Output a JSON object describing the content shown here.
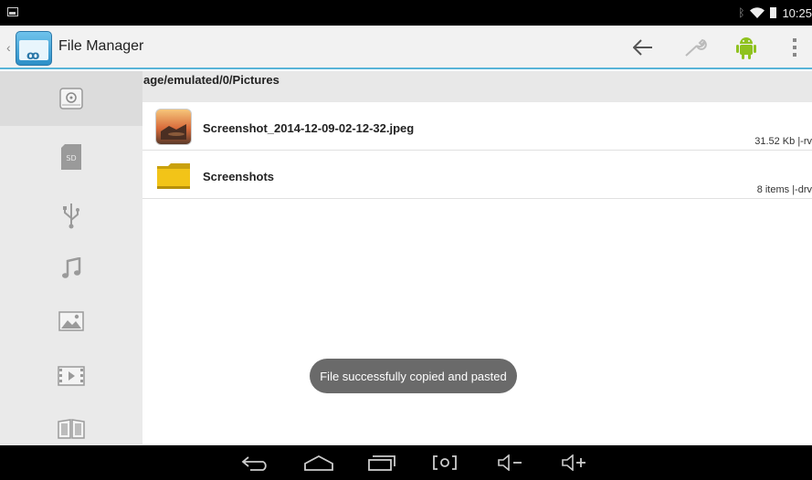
{
  "status_bar": {
    "time": "10:25",
    "icons": [
      "notification-icon",
      "bluetooth-icon",
      "wifi-icon",
      "battery-icon"
    ]
  },
  "action_bar": {
    "title": "File Manager",
    "icons": [
      "back-arrow-icon",
      "wrench-icon",
      "android-icon",
      "overflow-menu-icon"
    ],
    "accent_color": "#58b4d8"
  },
  "sidebar": {
    "items": [
      {
        "icon": "internal-storage-icon",
        "active": true
      },
      {
        "icon": "sd-card-icon",
        "label": "SD"
      },
      {
        "icon": "usb-icon"
      },
      {
        "icon": "music-icon"
      },
      {
        "icon": "image-icon"
      },
      {
        "icon": "video-icon"
      },
      {
        "icon": "book-icon"
      }
    ]
  },
  "breadcrumb": {
    "path": "age/emulated/0/Pictures"
  },
  "files": [
    {
      "name": "Screenshot_2014-12-09-02-12-32.jpeg",
      "meta": "31.52 Kb |-rv",
      "icon": "image-file-icon"
    },
    {
      "name": "Screenshots",
      "meta": "8 items |-drv",
      "icon": "folder-icon"
    }
  ],
  "toast": {
    "message": "File successfully copied and pasted"
  },
  "nav_bar": {
    "buttons": [
      "back-icon",
      "home-icon",
      "recents-icon",
      "screenshot-icon",
      "volume-down-icon",
      "volume-up-icon"
    ]
  }
}
